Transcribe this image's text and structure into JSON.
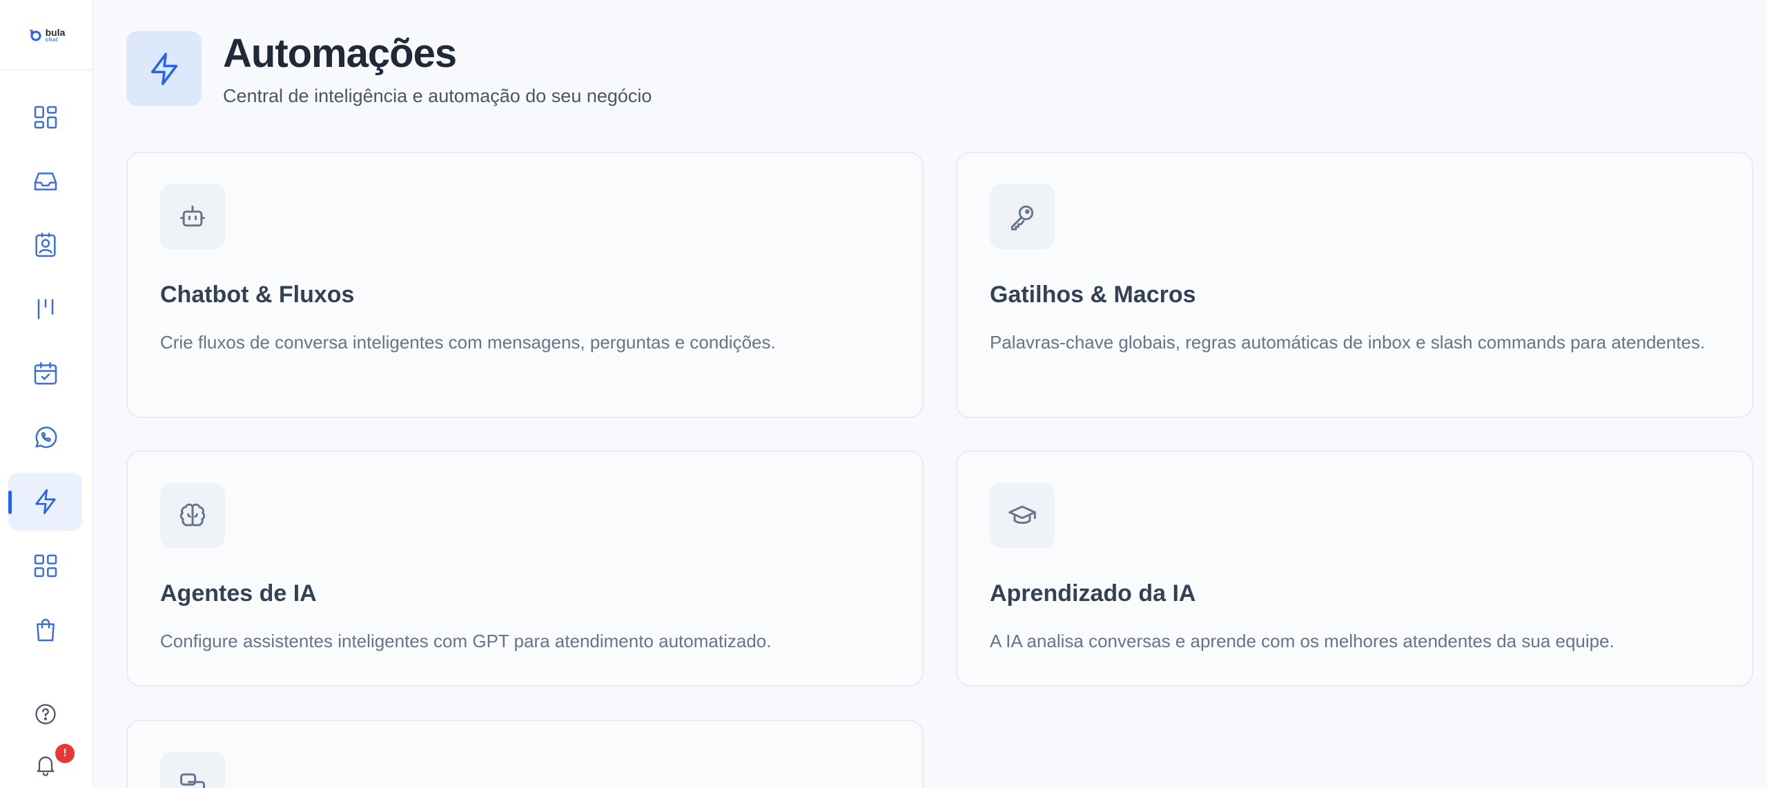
{
  "logo": {
    "word": "bula",
    "sub": "chat"
  },
  "sidebar": {
    "items": [
      {
        "name": "dashboard",
        "icon": "dashboard-icon"
      },
      {
        "name": "inbox",
        "icon": "inbox-icon"
      },
      {
        "name": "contacts",
        "icon": "contact-card-icon"
      },
      {
        "name": "pipeline",
        "icon": "kanban-icon"
      },
      {
        "name": "calendar",
        "icon": "calendar-check-icon"
      },
      {
        "name": "whatsapp",
        "icon": "whatsapp-icon"
      },
      {
        "name": "automations",
        "icon": "lightning-icon",
        "active": true
      },
      {
        "name": "apps",
        "icon": "grid-icon"
      },
      {
        "name": "store",
        "icon": "shopping-bag-icon"
      }
    ],
    "notification_badge": "!"
  },
  "header": {
    "title": "Automações",
    "subtitle": "Central de inteligência e automação do seu negócio"
  },
  "cards": [
    {
      "title": "Chatbot & Fluxos",
      "desc": "Crie fluxos de conversa inteligentes com mensagens, perguntas e condições.",
      "icon": "robot-icon"
    },
    {
      "title": "Gatilhos & Macros",
      "desc": "Palavras-chave globais, regras automáticas de inbox e slash commands para atendentes.",
      "icon": "key-icon"
    },
    {
      "title": "Agentes de IA",
      "desc": "Configure assistentes inteligentes com GPT para atendimento automatizado.",
      "icon": "brain-icon"
    },
    {
      "title": "Aprendizado da IA",
      "desc": "A IA analisa conversas e aprende com os melhores atendentes da sua equipe.",
      "icon": "graduation-cap-icon"
    },
    {
      "title": "",
      "desc": "",
      "icon": "messages-icon"
    }
  ],
  "colors": {
    "accent": "#2563eb",
    "sidebar_icon": "#3b6fd8",
    "card_icon": "#64748b",
    "badge": "#e53935",
    "background": "#f7f9fc"
  }
}
